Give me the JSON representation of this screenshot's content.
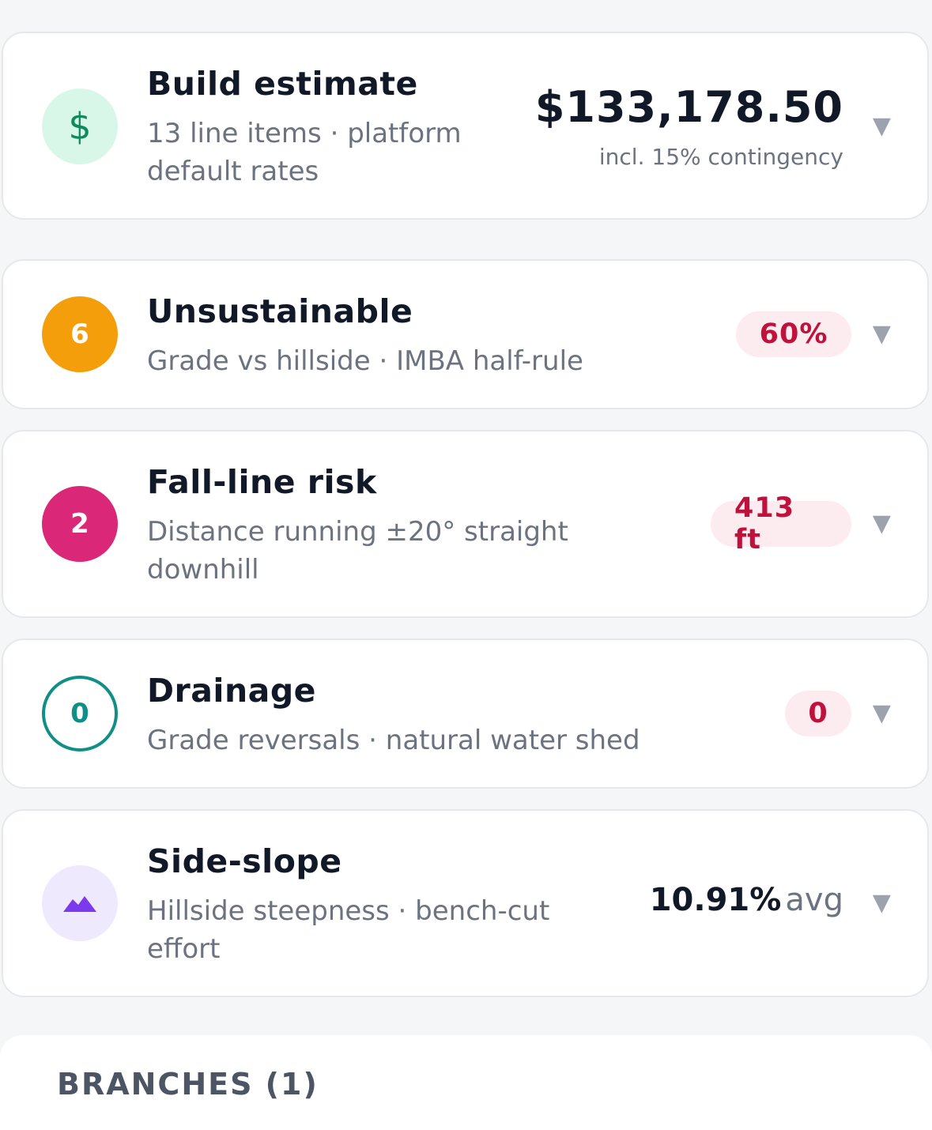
{
  "build": {
    "icon": "dollar-icon",
    "icon_glyph": "$",
    "title": "Build estimate",
    "subtitle": "13 line items · platform default rates",
    "amount": "$133,178.50",
    "note": "incl. 15% contingency"
  },
  "unsustainable": {
    "count": "6",
    "title": "Unsustainable",
    "subtitle": "Grade vs hillside · IMBA half-rule",
    "value": "60%"
  },
  "fall_line": {
    "count": "2",
    "title": "Fall-line risk",
    "subtitle": "Distance running ±20° straight downhill",
    "value": "413 ft"
  },
  "drainage": {
    "count": "0",
    "title": "Drainage",
    "subtitle": "Grade reversals · natural water shed",
    "value": "0"
  },
  "side_slope": {
    "icon": "mountain-icon",
    "title": "Side-slope",
    "subtitle": "Hillside steepness · bench-cut effort",
    "value": "10.91%",
    "unit": "avg"
  },
  "chevron": "▼",
  "branches": {
    "label": "BRANCHES (1)"
  },
  "colors": {
    "green": "#0f8a5f",
    "green_bg": "#d9f7e8",
    "orange": "#f59e0b",
    "pink": "#db2777",
    "teal": "#0f8f86",
    "purple": "#7c3aed",
    "purple_bg": "#efe9fd",
    "pill_bg": "#fdecef",
    "pill_text": "#be123c"
  }
}
